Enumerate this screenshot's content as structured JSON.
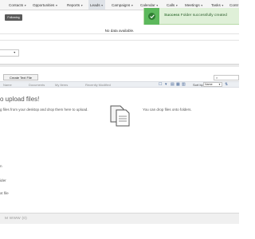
{
  "nav": {
    "items": [
      {
        "label": "Contacts",
        "has_caret": true
      },
      {
        "label": "Opportunities",
        "has_caret": true
      },
      {
        "label": "Reports",
        "has_caret": true
      },
      {
        "label": "Leads",
        "has_caret": true,
        "active": true
      },
      {
        "label": "Campaigns",
        "has_caret": true
      },
      {
        "label": "Calendar",
        "has_caret": true
      },
      {
        "label": "Calls",
        "has_caret": true
      },
      {
        "label": "Meetings",
        "has_caret": true
      },
      {
        "label": "Tasks",
        "has_caret": true
      },
      {
        "label": "Contr",
        "has_caret": false
      }
    ],
    "caret_glyph": "▼"
  },
  "following": {
    "label": "Following"
  },
  "toast": {
    "bold": "Success",
    "message": " Folder successfully created",
    "color": "#5cb85c",
    "icon": "check-circle-icon"
  },
  "dashlet": {
    "no_data": "No data available."
  },
  "toolbar": {
    "create_text_file": "Create Text File",
    "sort_by_label": "Sort by:",
    "sort_by_value": "Name"
  },
  "columns": [
    "Name",
    "Documents",
    "My Items",
    "Recently Modified"
  ],
  "upload": {
    "title": "o upload files!",
    "desc": "g files from your desktop and drop them here to upload.",
    "drop_text": "You can drop files onto folders."
  },
  "side_text": [
    "n",
    "ider",
    "xt file"
  ],
  "footer": {
    "label": "M WWW (0)"
  }
}
